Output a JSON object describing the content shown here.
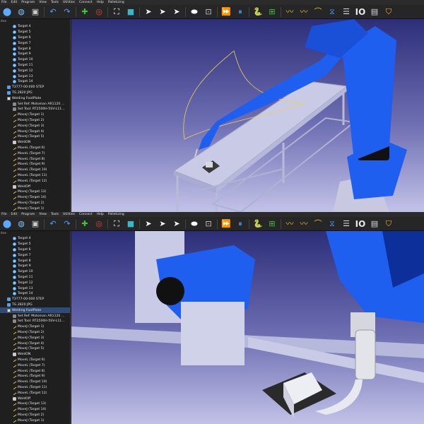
{
  "menu": [
    "File",
    "Edit",
    "Program",
    "View",
    "Tools",
    "Utilities",
    "Connect",
    "Help",
    "Palletizing"
  ],
  "toolbar": {
    "counter_label": "IO"
  },
  "tree": {
    "header": "ites",
    "top_items": [
      {
        "label": "Target 4",
        "icon": "target"
      },
      {
        "label": "Target 5",
        "icon": "target"
      },
      {
        "label": "Target 6",
        "icon": "target"
      },
      {
        "label": "Target 7",
        "icon": "target"
      },
      {
        "label": "Target 8",
        "icon": "target"
      },
      {
        "label": "Target 9",
        "icon": "target"
      },
      {
        "label": "Target 10",
        "icon": "target"
      },
      {
        "label": "Target 11",
        "icon": "target"
      },
      {
        "label": "Target 12",
        "icon": "target"
      },
      {
        "label": "Target 13",
        "icon": "target"
      },
      {
        "label": "Target 14",
        "icon": "target"
      },
      {
        "label": "T3777-00-000 STEP",
        "icon": "file"
      },
      {
        "label": "TG.2820 JPG",
        "icon": "file"
      },
      {
        "label": "Welding FootPlate",
        "icon": "prog"
      },
      {
        "label": "Set Ref: Motoman AR1120 ...",
        "icon": "set"
      },
      {
        "label": "Set Tool: RT2500H-5SV-L11...",
        "icon": "set"
      },
      {
        "label": "MoveJ (Target 1)",
        "icon": "move"
      },
      {
        "label": "MoveJ (Target 2)",
        "icon": "move"
      },
      {
        "label": "MoveJ (Target 3)",
        "icon": "move"
      },
      {
        "label": "MoveJ (Target 4)",
        "icon": "move"
      },
      {
        "label": "MoveJ (Target 5)",
        "icon": "move"
      },
      {
        "label": "WeldON",
        "icon": "weld"
      },
      {
        "label": "MoveL (Target 6)",
        "icon": "move"
      },
      {
        "label": "MoveL (Target 7)",
        "icon": "move"
      },
      {
        "label": "MoveL (Target 8)",
        "icon": "move"
      },
      {
        "label": "MoveL (Target 9)",
        "icon": "move"
      },
      {
        "label": "MoveL (Target 10)",
        "icon": "move"
      },
      {
        "label": "MoveL (Target 11)",
        "icon": "move"
      },
      {
        "label": "MoveL (Target 12)",
        "icon": "move"
      },
      {
        "label": "WeldOff",
        "icon": "weld"
      },
      {
        "label": "MoveJ (Target 13)",
        "icon": "move"
      },
      {
        "label": "MoveJ (Target 14)",
        "icon": "move"
      },
      {
        "label": "MoveJ (Target 2)",
        "icon": "move"
      },
      {
        "label": "MoveJ (Target 1)",
        "icon": "move"
      }
    ],
    "bottom_items": [
      {
        "label": "Target 4",
        "icon": "target"
      },
      {
        "label": "Target 5",
        "icon": "target"
      },
      {
        "label": "Target 6",
        "icon": "target"
      },
      {
        "label": "Target 7",
        "icon": "target"
      },
      {
        "label": "Target 8",
        "icon": "target"
      },
      {
        "label": "Target 9",
        "icon": "target"
      },
      {
        "label": "Target 10",
        "icon": "target"
      },
      {
        "label": "Target 11",
        "icon": "target"
      },
      {
        "label": "Target 12",
        "icon": "target"
      },
      {
        "label": "Target 13",
        "icon": "target"
      },
      {
        "label": "Target 14",
        "icon": "target"
      },
      {
        "label": "T3777-00-000 STEP",
        "icon": "file"
      },
      {
        "label": "TG.2820 JPG",
        "icon": "file"
      },
      {
        "label": "Welding FootPlate",
        "icon": "prog",
        "selected": true
      },
      {
        "label": "Set Ref: Motoman AR1120 ...",
        "icon": "set"
      },
      {
        "label": "Set Tool: RT2500H-5SV-L11...",
        "icon": "set"
      },
      {
        "label": "MoveJ (Target 1)",
        "icon": "move"
      },
      {
        "label": "MoveJ (Target 2)",
        "icon": "move"
      },
      {
        "label": "MoveJ (Target 3)",
        "icon": "move"
      },
      {
        "label": "MoveJ (Target 4)",
        "icon": "move"
      },
      {
        "label": "MoveJ (Target 5)",
        "icon": "move"
      },
      {
        "label": "WeldON",
        "icon": "weld"
      },
      {
        "label": "MoveL (Target 6)",
        "icon": "move"
      },
      {
        "label": "MoveL (Target 7)",
        "icon": "move"
      },
      {
        "label": "MoveL (Target 8)",
        "icon": "move"
      },
      {
        "label": "MoveL (Target 9)",
        "icon": "move"
      },
      {
        "label": "MoveL (Target 10)",
        "icon": "move"
      },
      {
        "label": "MoveL (Target 11)",
        "icon": "move"
      },
      {
        "label": "MoveL (Target 12)",
        "icon": "move"
      },
      {
        "label": "WeldOff",
        "icon": "weld"
      },
      {
        "label": "MoveJ (Target 13)",
        "icon": "move"
      },
      {
        "label": "MoveJ (Target 14)",
        "icon": "move"
      },
      {
        "label": "MoveJ (Target 2)",
        "icon": "move"
      },
      {
        "label": "MoveJ (Target 1)",
        "icon": "move"
      }
    ]
  },
  "colors": {
    "robot": "#1e5ff0",
    "robot_dark": "#0d2f9a",
    "table": "#c9cbe6",
    "path": "#e9d44a",
    "selection": "#2f4c78"
  }
}
